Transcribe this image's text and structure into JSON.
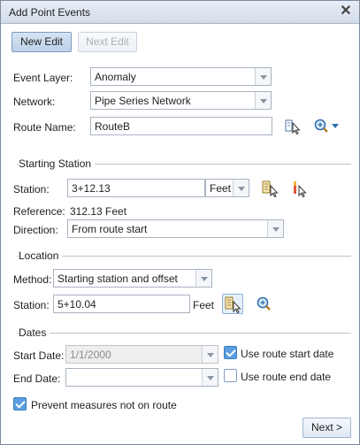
{
  "dialog": {
    "title": "Add Point Events",
    "close_glyph": "✕"
  },
  "toolbar": {
    "new_edit_label": "New Edit",
    "next_edit_label": "Next Edit"
  },
  "event_layer": {
    "label": "Event Layer:",
    "value": "Anomaly"
  },
  "network": {
    "label": "Network:",
    "value": "Pipe Series Network"
  },
  "route_name": {
    "label": "Route Name:",
    "value": "RouteB"
  },
  "starting_station": {
    "header": "Starting Station",
    "station_label": "Station:",
    "station_value": "3+12.13",
    "units_value": "Feet",
    "reference_label": "Reference:",
    "reference_value": "312.13 Feet",
    "direction_label": "Direction:",
    "direction_value": "From route start"
  },
  "location": {
    "header": "Location",
    "method_label": "Method:",
    "method_value": "Starting station and offset",
    "station_label": "Station:",
    "station_value": "5+10.04",
    "units_label": "Feet"
  },
  "dates": {
    "header": "Dates",
    "start_label": "Start Date:",
    "start_value": "1/1/2000",
    "use_start_label": "Use route start date",
    "use_start_checked": true,
    "end_label": "End Date:",
    "end_value": "",
    "use_end_label": "Use route end date",
    "use_end_checked": false
  },
  "prevent": {
    "label": "Prevent measures not on route",
    "checked": true
  },
  "footer": {
    "next_label": "Next >"
  },
  "colors": {
    "accent": "#5a9ee0",
    "title_bar": "#dde6f0"
  },
  "icons": [
    "close-icon",
    "select-route-on-map-icon",
    "zoom-to-route-icon",
    "chevron-down-icon",
    "select-station-on-map-icon",
    "select-measure-on-map-icon",
    "zoom-to-location-icon",
    "checkmark-icon"
  ]
}
